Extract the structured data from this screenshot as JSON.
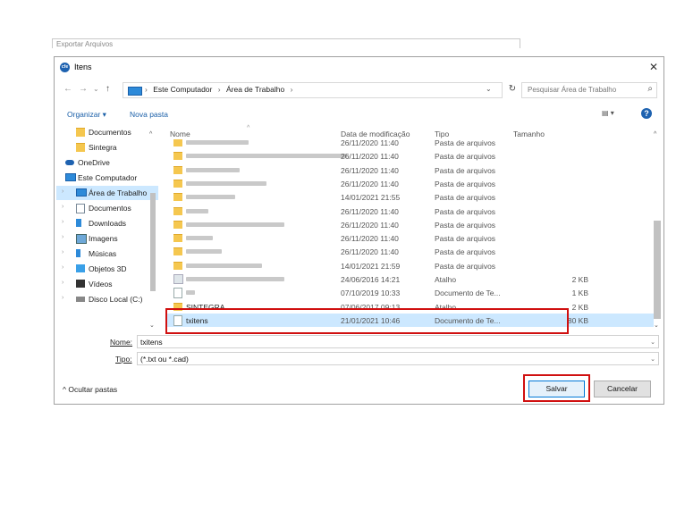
{
  "background_window": {
    "title": "Exportar Arquivos"
  },
  "dialog": {
    "title": "Itens",
    "app_icon": "app-logo-icon",
    "close_glyph": "✕"
  },
  "nav": {
    "back": "←",
    "forward": "→",
    "recent": "⌄",
    "up": "↑",
    "breadcrumbs": [
      "Este Computador",
      "Área de Trabalho"
    ],
    "separator": "›",
    "refresh": "↻",
    "search_placeholder": "Pesquisar Área de Trabalho"
  },
  "toolbar": {
    "organize": "Organizar ▾",
    "new_folder": "Nova pasta",
    "view": "▤ ▾",
    "help": "?"
  },
  "sidebar": {
    "items": [
      {
        "label": "Documentos",
        "icon": "folder-icon",
        "expander": ""
      },
      {
        "label": "Sintegra",
        "icon": "folder-icon",
        "expander": ""
      },
      {
        "label": "OneDrive",
        "icon": "cloud-icon",
        "expander": "›"
      },
      {
        "label": "Este Computador",
        "icon": "computer-icon",
        "expander": "⌄"
      },
      {
        "label": "Área de Trabalho",
        "icon": "desktop-icon",
        "expander": "›"
      },
      {
        "label": "Documentos",
        "icon": "documents-icon",
        "expander": "›"
      },
      {
        "label": "Downloads",
        "icon": "download-icon",
        "expander": "›"
      },
      {
        "label": "Imagens",
        "icon": "pictures-icon",
        "expander": "›"
      },
      {
        "label": "Músicas",
        "icon": "music-icon",
        "expander": "›"
      },
      {
        "label": "Objetos 3D",
        "icon": "cube-icon",
        "expander": "›"
      },
      {
        "label": "Vídeos",
        "icon": "video-icon",
        "expander": "›"
      },
      {
        "label": "Disco Local (C:)",
        "icon": "drive-icon",
        "expander": "›"
      }
    ]
  },
  "columns": {
    "name": "Nome",
    "date": "Data de modificação",
    "type": "Tipo",
    "size": "Tamanho"
  },
  "files": [
    {
      "name": "",
      "date": "26/11/2020 11:40",
      "type": "Pasta de arquivos",
      "size": "",
      "kind": "folder"
    },
    {
      "name": "",
      "date": "26/11/2020 11:40",
      "type": "Pasta de arquivos",
      "size": "",
      "kind": "folder"
    },
    {
      "name": "",
      "date": "26/11/2020 11:40",
      "type": "Pasta de arquivos",
      "size": "",
      "kind": "folder"
    },
    {
      "name": "",
      "date": "26/11/2020 11:40",
      "type": "Pasta de arquivos",
      "size": "",
      "kind": "folder"
    },
    {
      "name": "",
      "date": "14/01/2021 21:55",
      "type": "Pasta de arquivos",
      "size": "",
      "kind": "folder"
    },
    {
      "name": "",
      "date": "26/11/2020 11:40",
      "type": "Pasta de arquivos",
      "size": "",
      "kind": "folder"
    },
    {
      "name": "",
      "date": "26/11/2020 11:40",
      "type": "Pasta de arquivos",
      "size": "",
      "kind": "folder"
    },
    {
      "name": "",
      "date": "26/11/2020 11:40",
      "type": "Pasta de arquivos",
      "size": "",
      "kind": "folder"
    },
    {
      "name": "",
      "date": "26/11/2020 11:40",
      "type": "Pasta de arquivos",
      "size": "",
      "kind": "folder"
    },
    {
      "name": "",
      "date": "14/01/2021 21:59",
      "type": "Pasta de arquivos",
      "size": "",
      "kind": "folder"
    },
    {
      "name": "",
      "date": "24/06/2016 14:21",
      "type": "Atalho",
      "size": "2 KB",
      "kind": "link"
    },
    {
      "name": "",
      "date": "07/10/2019 10:33",
      "type": "Documento de Te...",
      "size": "1 KB",
      "kind": "doc"
    },
    {
      "name": "SINTEGRA",
      "date": "07/06/2017 09:13",
      "type": "Atalho",
      "size": "2 KB",
      "kind": "folder"
    },
    {
      "name": "txitens",
      "date": "21/01/2021 10:46",
      "type": "Documento de Te...",
      "size": "80 KB",
      "kind": "doc",
      "selected": true
    }
  ],
  "form": {
    "name_label": "Nome:",
    "name_value": "txitens",
    "type_label": "Tipo:",
    "type_value": "(*.txt ou *.cad)",
    "dropdown_glyph": "⌄"
  },
  "footer": {
    "hide_folders": "Ocultar pastas",
    "hide_glyph": "^",
    "save": "Salvar",
    "cancel": "Cancelar"
  },
  "colors": {
    "accent": "#1e62b0",
    "selection": "#cce8ff",
    "highlight_box": "#d01010"
  }
}
